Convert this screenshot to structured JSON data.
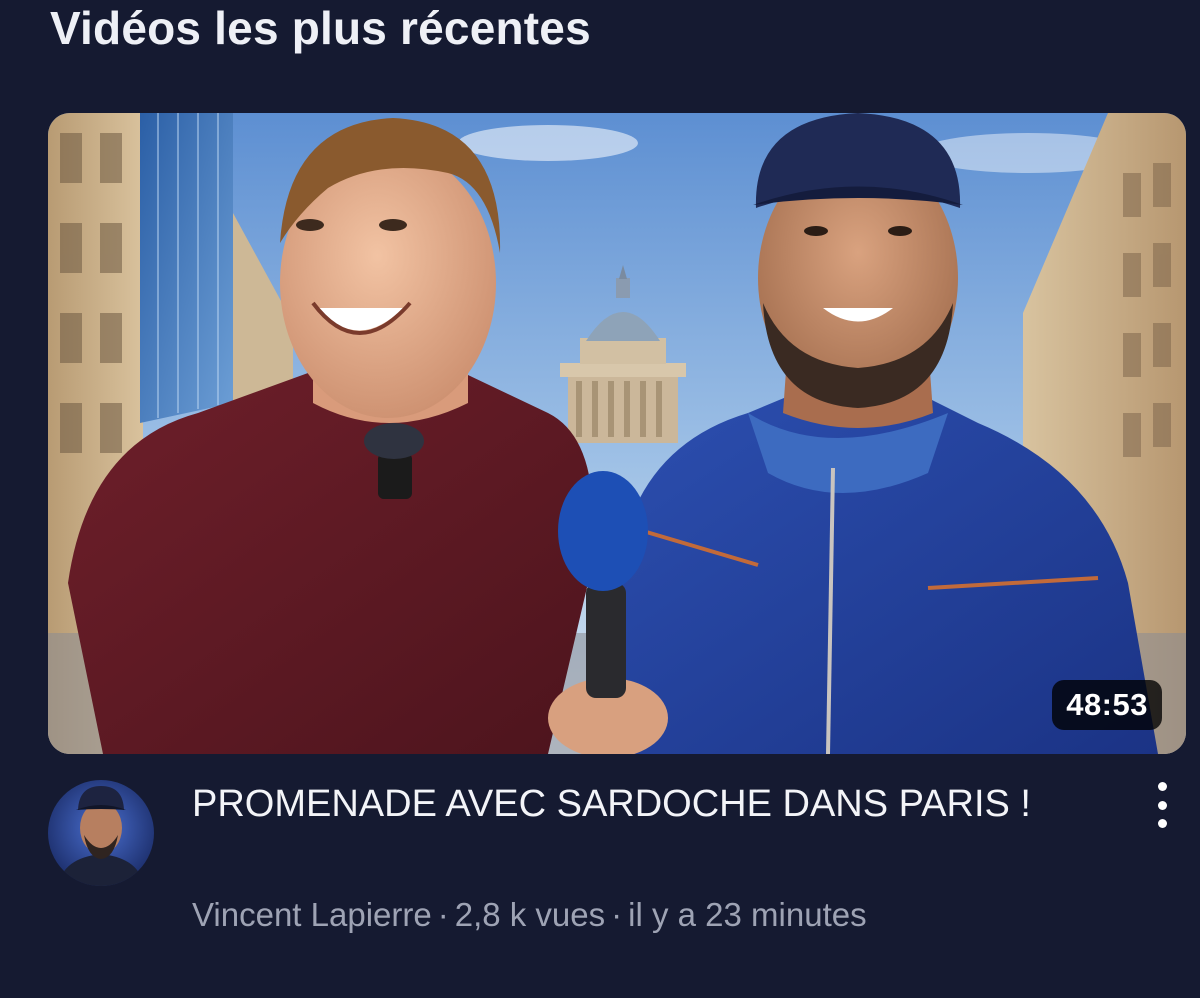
{
  "section": {
    "title": "Vidéos les plus récentes"
  },
  "video": {
    "duration": "48:53",
    "title": "PROMENADE AVEC SARDOCHE DANS PARIS !",
    "channel": "Vincent Lapierre",
    "separator": "·",
    "views": "2,8 k vues",
    "published": "il y a 23 minutes",
    "thumbnail_icon": "video-thumbnail",
    "avatar_icon": "channel-avatar",
    "menu_icon": "more-vertical-icon"
  },
  "colors": {
    "background": "#151a31",
    "title_text": "#f3f4f8",
    "meta_text": "#9ea3b4",
    "duration_badge": "#000000"
  }
}
